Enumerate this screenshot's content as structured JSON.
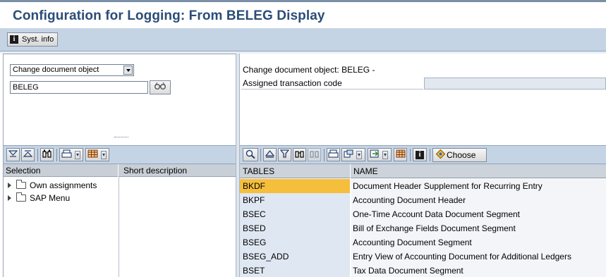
{
  "window": {
    "title": "Configuration for Logging: From BELEG Display"
  },
  "app_toolbar": {
    "syst_info_label": "Syst. info"
  },
  "left_panel": {
    "object_type_select": "Change document object",
    "object_input_value": "BELEG",
    "columns": {
      "selection": "Selection",
      "short_description": "Short description"
    },
    "tree": [
      {
        "label": "Own assignments"
      },
      {
        "label": "SAP Menu"
      }
    ]
  },
  "right_panel": {
    "change_doc_object_text": "Change document object: BELEG -",
    "assigned_tx_label": "Assigned transaction code",
    "toolbar": {
      "choose_label": "Choose"
    },
    "grid": {
      "columns": [
        "TABLES",
        "NAME"
      ],
      "rows": [
        {
          "table": "BKDF",
          "name": "Document Header Supplement for Recurring Entry",
          "selected": true
        },
        {
          "table": "BKPF",
          "name": "Accounting Document Header"
        },
        {
          "table": "BSEC",
          "name": "One-Time Account Data Document Segment"
        },
        {
          "table": "BSED",
          "name": "Bill of Exchange Fields Document Segment"
        },
        {
          "table": "BSEG",
          "name": "Accounting Document Segment"
        },
        {
          "table": "BSEG_ADD",
          "name": "Entry View of Accounting Document for Additional Ledgers"
        },
        {
          "table": "BSET",
          "name": "Tax Data Document Segment"
        }
      ]
    }
  },
  "colors": {
    "title_text": "#2b4c77",
    "toolbar_bg": "#c5d4e5",
    "selected_cell": "#f5be3c",
    "grid_key_cell": "#dfe7f2"
  }
}
